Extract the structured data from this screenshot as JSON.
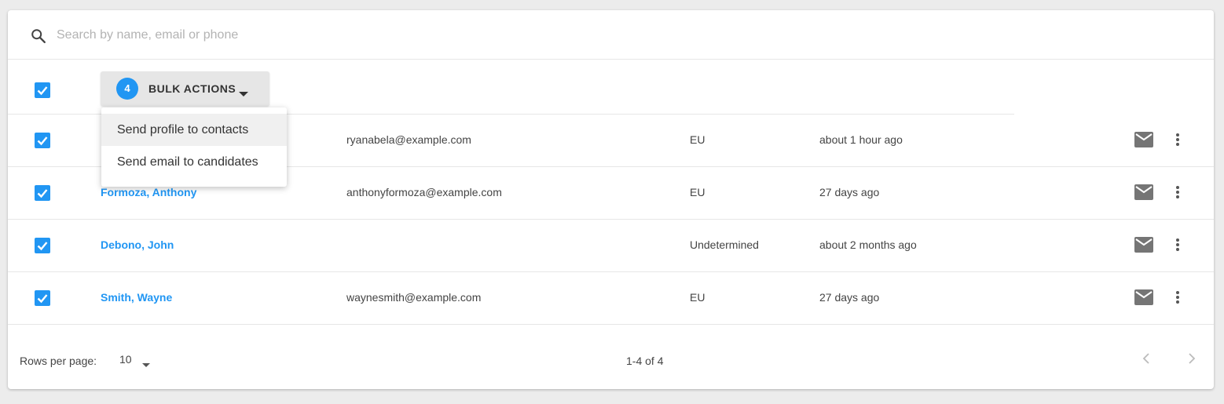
{
  "search": {
    "placeholder": "Search by name, email or phone",
    "value": ""
  },
  "bulk_actions": {
    "selected_count": "4",
    "label": "BULK ACTIONS",
    "menu": [
      {
        "label": "Send profile to contacts"
      },
      {
        "label": "Send email to candidates"
      }
    ]
  },
  "rows": [
    {
      "name": "",
      "email": "ryanabela@example.com",
      "region": "EU",
      "updated": "about 1 hour ago"
    },
    {
      "name": "Formoza, Anthony",
      "email": "anthonyformoza@example.com",
      "region": "EU",
      "updated": "27 days ago"
    },
    {
      "name": "Debono, John",
      "email": "",
      "region": "Undetermined",
      "updated": "about 2 months ago"
    },
    {
      "name": "Smith, Wayne",
      "email": "waynesmith@example.com",
      "region": "EU",
      "updated": "27 days ago"
    }
  ],
  "footer": {
    "rows_per_page_label": "Rows per page:",
    "rows_per_page_value": "10",
    "range_text": "1-4 of 4"
  },
  "colors": {
    "accent": "#2196f3",
    "icon_gray": "#757575",
    "background": "#ececec"
  },
  "icons": {
    "search": "search-icon",
    "checkbox": "check-icon",
    "caret": "caret-down-icon",
    "mail": "mail-icon",
    "more": "more-vert-icon",
    "prev": "chevron-left-icon",
    "next": "chevron-right-icon"
  }
}
